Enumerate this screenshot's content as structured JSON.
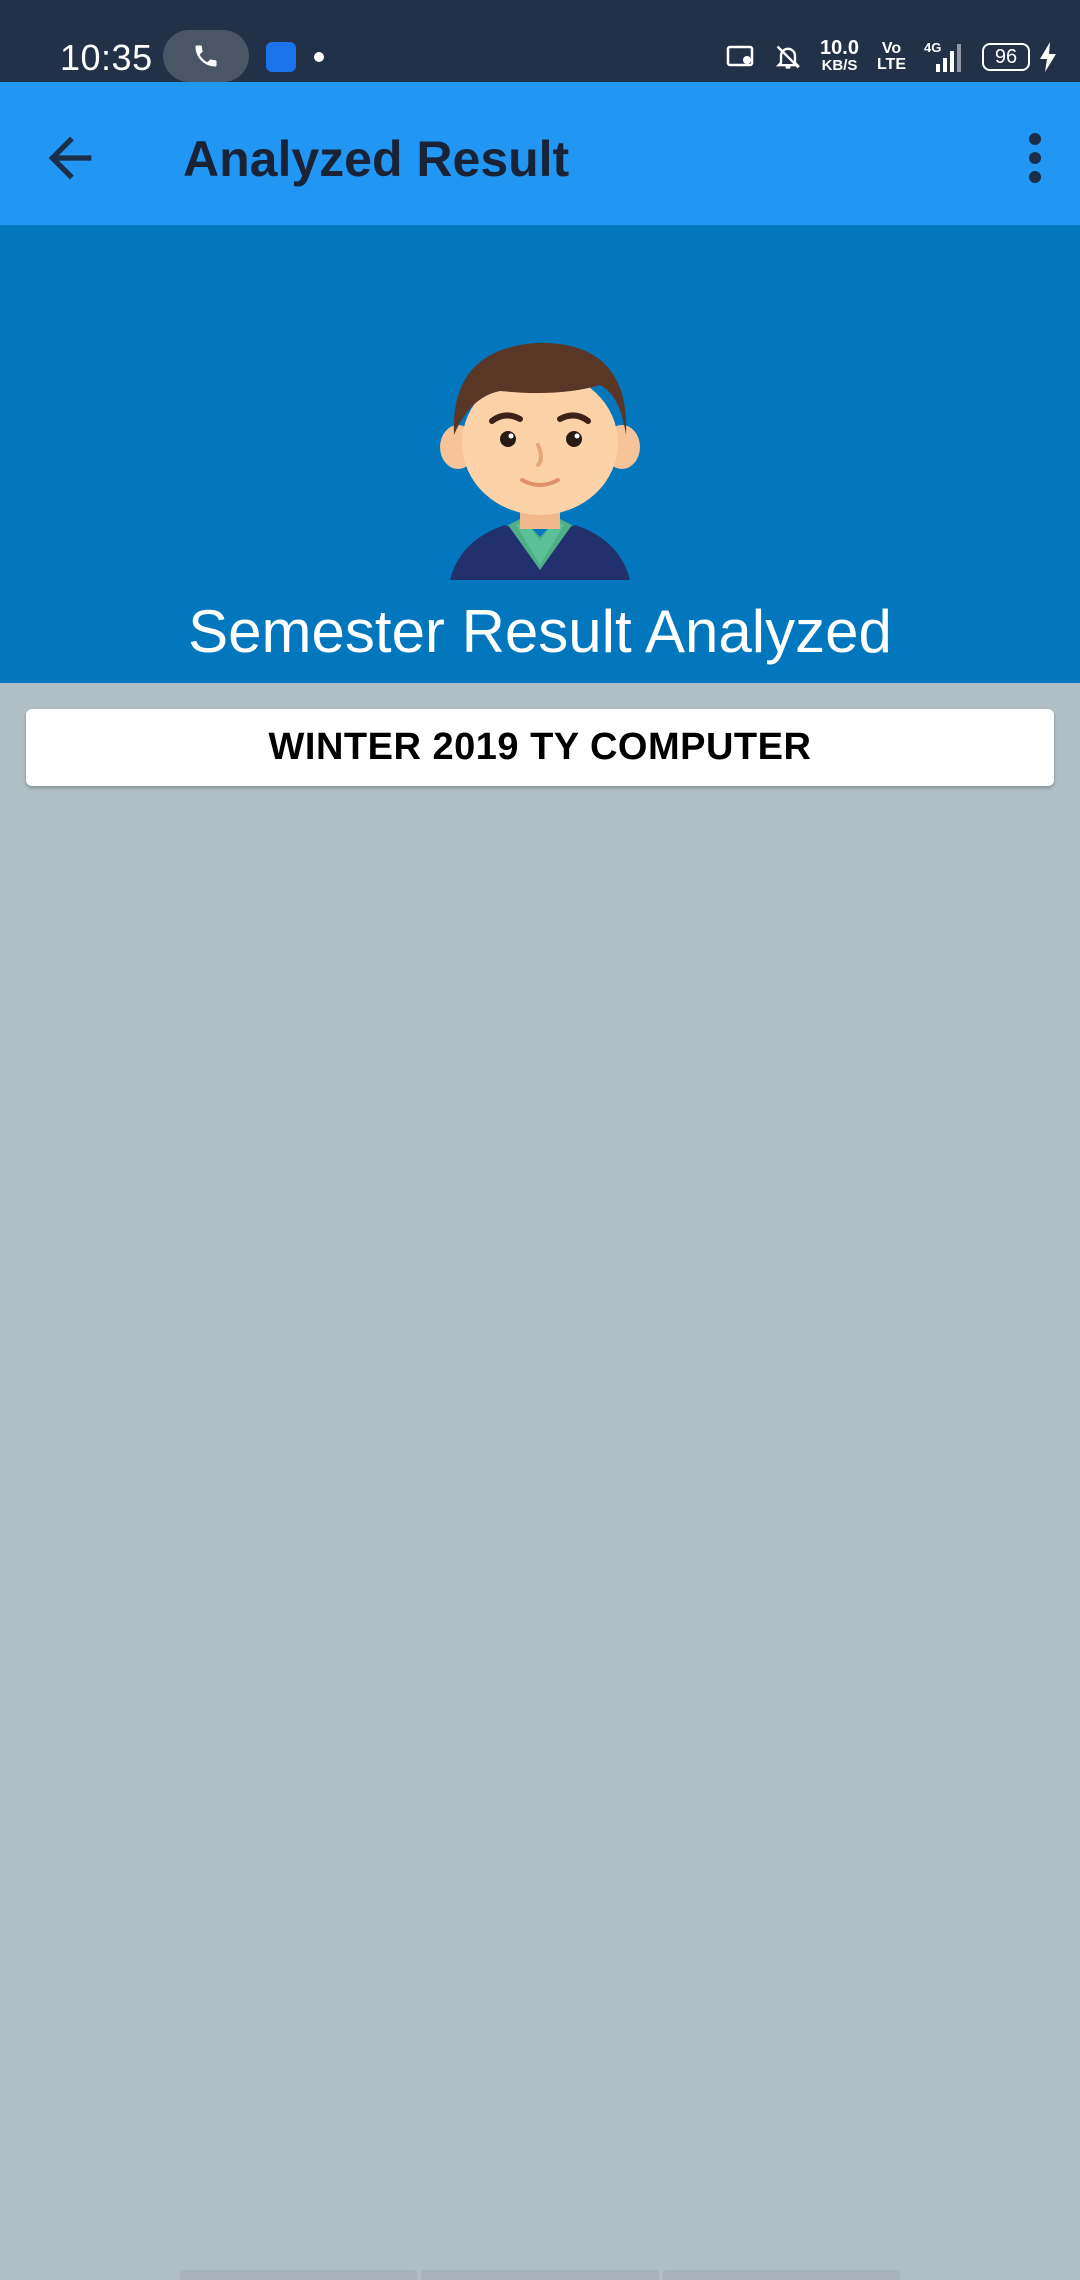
{
  "status_bar": {
    "time": "10:35",
    "speed_value": "10.0",
    "speed_unit": "KB/S",
    "volte_top": "Vo",
    "volte_bottom": "LTE",
    "network": "4G",
    "battery": "96"
  },
  "app_bar": {
    "title": "Analyzed Result",
    "back_icon": "arrow-back-icon",
    "menu_icon": "more-vert-icon",
    "color": "#2196f3"
  },
  "header": {
    "title": "Semester Result Analyzed",
    "color": "#0277bd"
  },
  "result_card": {
    "label": "WINTER 2019 TY COMPUTER"
  }
}
